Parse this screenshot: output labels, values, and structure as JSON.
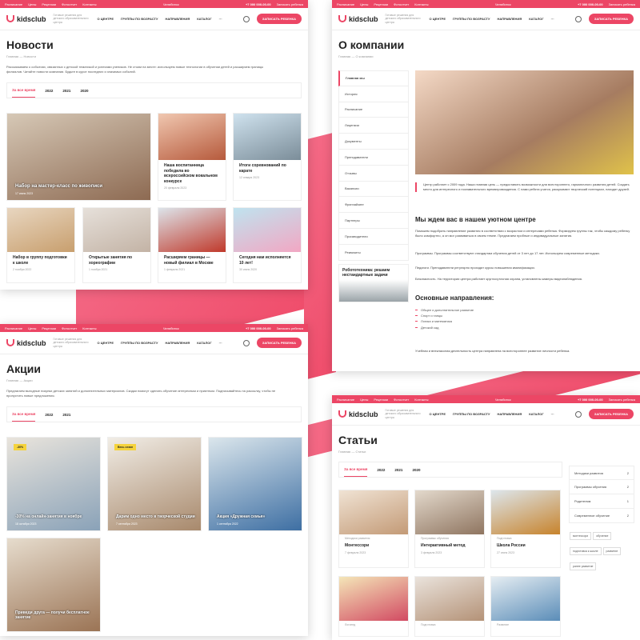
{
  "colors": {
    "accent": "#ec4665"
  },
  "topbar": {
    "links": [
      "Расписание",
      "Цены",
      "Рецензии",
      "Фотоотчет",
      "Контакты"
    ],
    "city": "Челябинск",
    "phone": "+7 000 000-00-00",
    "callback": "Записать ребенка"
  },
  "header": {
    "logo": "kidsclub",
    "tagline": "Готовые решения для детского образовательного центра",
    "menu": [
      "О ЦЕНТРЕ",
      "ГРУППЫ ПО ВОЗРАСТУ",
      "НАПРАВЛЕНИЯ",
      "КАТАЛОГ",
      "···"
    ],
    "cta": "ЗАПИСАТЬ РЕБЕНКА"
  },
  "news": {
    "title": "Новости",
    "breadcrumb": "Главная — Новости",
    "description": "Рассказываем о событиях, связанных с детской тематикой и успехами учеников. Не стоим на месте: используем новые технологии в обучении детей и расширяем границы филиалов. Читайте новости компании. Будьте в курсе последних и значимых событий.",
    "tabs": [
      "За все время",
      "2022",
      "2021",
      "2020"
    ],
    "cards": [
      {
        "caption": "Набор на мастер-класс по живописи",
        "date": "17 июня 2023"
      },
      {
        "caption": "Наша воспитанница победила во всероссийском вокальном конкурсе",
        "date": "20 февраля 2023"
      },
      {
        "caption": "Итоги соревнований по карате",
        "date": "12 января 2023"
      },
      {
        "caption": "Набор в группу подготовки к школе",
        "date": "2 ноября 2022"
      },
      {
        "caption": "Открытые занятия по хореографии",
        "date": "1 ноября 2021"
      },
      {
        "caption": "Расширяем границы — новый филиал в Москве",
        "date": "1 февраля 2021"
      },
      {
        "caption": "Сегодня нам исполняется 10 лет!",
        "date": "30 июня 2020"
      }
    ]
  },
  "about": {
    "title": "О компании",
    "breadcrumb": "Главная — О компании",
    "side": [
      "Главная мы",
      "История",
      "Расписание",
      "Лицензии",
      "Документы",
      "Преподаватели",
      "Отзывы",
      "Вакансии",
      "Франчайзинг",
      "Партнеры",
      "Производители",
      "Реквизиты"
    ],
    "promo": "Робототехника: решаем нестандартные задачи",
    "quote": "Центр работает с 2009 года. Наша главная цель — предоставить возможности для всестороннего, гармоничного развития детей. Создать место для интересного и познавательного времяпровождения. С нами ребята учатся, раскрывают творческий потенциал, находят друзей.",
    "h_welcome": "Мы ждем вас в нашем уютном центре",
    "p1": "Поможем подобрать направление развития в соответствии с возрастом и интересами ребенка. Формируем группы так, чтобы каждому ребенку было комфортно, а он мог развиваться в своем темпе. Предлагаем пробные и индивидуальные занятия.",
    "b1": "Программы. Программы соответствуют стандартам обучения детей от 3 лет до 17 лет. Используем современные методики.",
    "b2": "Педагоги. Преподаватели регулярно проходят курсы повышения квалификации.",
    "b3": "Безопасность. На территории центра работает круглосуточная охрана, установлены камеры видеонаблюдения.",
    "h_dirs": "Основные направления:",
    "dirs": [
      "Общее и дополнительное развитие",
      "Спорт и танцы",
      "Логика и математика",
      "Детский сад"
    ],
    "p2": "Учебная и внеклассная деятельность центра направлена на всестороннее развитие личности ребенка."
  },
  "promo": {
    "title": "Акции",
    "breadcrumb": "Главная — Акции",
    "description": "Предлагаем выгодные покупки детских занятий и дополнительных материалов. Скидки помогут сделать обучение интересным и приятным. Подписывайтесь на рассылку, чтобы не пропустить новые предложения.",
    "tabs": [
      "За все время",
      "2022",
      "2021"
    ],
    "cards": [
      {
        "caption": "-30% на онлайн-занятия в ноябре",
        "badge": "-30%",
        "date": "18 октября 2023"
      },
      {
        "caption": "Дарим одно место в творческой студии",
        "badge": "Весь сезон",
        "date": "7 сентября 2023"
      },
      {
        "caption": "Акция «Дружная семья»",
        "badge": "",
        "date": "1 сентября 2022"
      },
      {
        "caption": "Приведи друга — получи бесплатное занятие",
        "badge": "",
        "date": ""
      }
    ]
  },
  "articles": {
    "title": "Статьи",
    "breadcrumb": "Главная — Статьи",
    "tabs": [
      "За все время",
      "2022",
      "2021",
      "2020"
    ],
    "cards": [
      {
        "tag": "Методики развития",
        "caption": "Монтессори",
        "date": "7 февраля 2023"
      },
      {
        "tag": "Программы обучения",
        "caption": "Интерактивный метод",
        "date": "3 февраля 2023"
      },
      {
        "tag": "Подготовка",
        "caption": "Школа России",
        "date": "27 июня 2023"
      },
      {
        "tag": "Логопед",
        "caption": "",
        "date": ""
      },
      {
        "tag": "Подготовка",
        "caption": "",
        "date": ""
      },
      {
        "tag": "Развитие",
        "caption": "",
        "date": ""
      }
    ],
    "side": [
      {
        "label": "Методики развития",
        "count": "2"
      },
      {
        "label": "Программы обучения",
        "count": "2"
      },
      {
        "label": "Родителям",
        "count": "1"
      },
      {
        "label": "Современное обучение",
        "count": "2"
      }
    ],
    "chips": [
      "монтессори",
      "обучение",
      "подготовка к школе",
      "развитие",
      "ранее развитие"
    ]
  }
}
